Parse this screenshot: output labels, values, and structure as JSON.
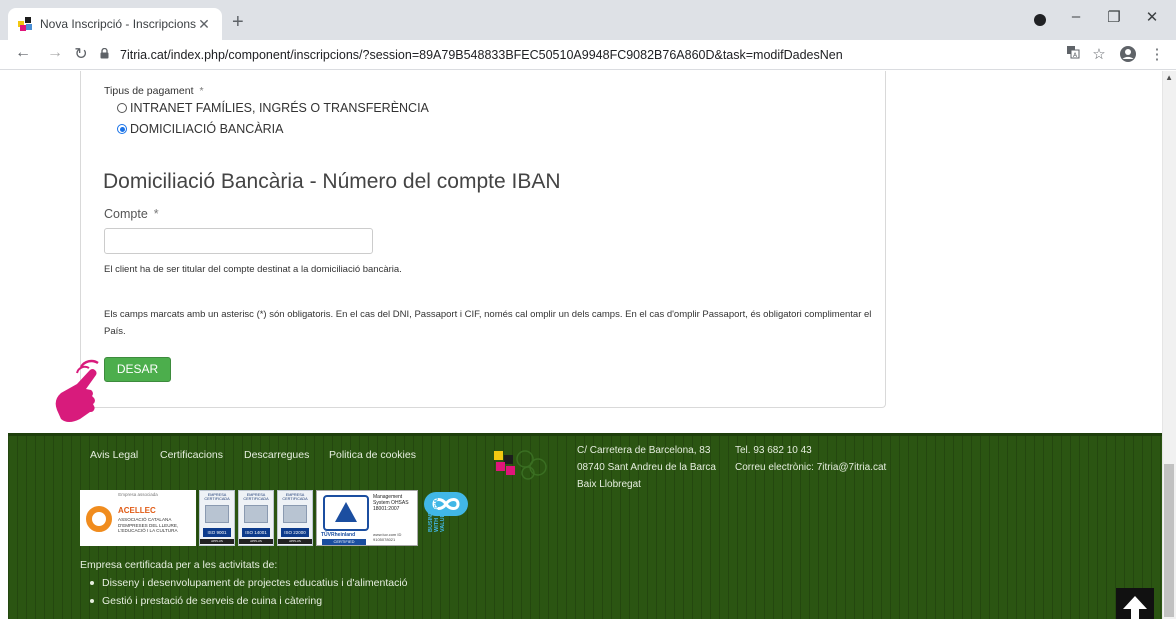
{
  "browser": {
    "tab_title": "Nova Inscripció - Inscripcions Me",
    "tab_close": "✕",
    "new_tab": "+",
    "url": "7itria.cat/index.php/component/inscripcions/?session=89A79B548833BFEC50510A9948FC9082B76A860D&task=modifDadesNen",
    "window_controls": {
      "minimize": "–",
      "restore": "❐",
      "close": "✕"
    },
    "nav": {
      "back": "←",
      "forward": "→",
      "reload": "↻"
    },
    "toolbar_icons": [
      "translate-icon",
      "star-icon",
      "profile-icon",
      "menu-icon"
    ]
  },
  "form": {
    "payment_label": "Tipus de pagament",
    "required_mark": "*",
    "payment_options": [
      {
        "label": "INTRANET FAMÍLIES, INGRÉS O TRANSFERÈNCIA",
        "selected": false
      },
      {
        "label": "DOMICILIACIÓ BANCÀRIA",
        "selected": true
      }
    ],
    "section_title": "Domiciliació Bancària - Número del compte IBAN",
    "account_label": "Compte",
    "account_value": "",
    "account_help": "El client ha de ser titular del compte destinat a la domiciliació bancària.",
    "required_note": "Els camps marcats amb un asterisc (*) són obligatoris. En el cas del DNI, Passaport i CIF, només cal omplir un dels camps. En el cas d'omplir Passaport, és obligatori complimentar el País.",
    "save_label": "DESAR"
  },
  "footer": {
    "links": [
      "Avis Legal",
      "Certificacions",
      "Descarregues",
      "Politica de cookies"
    ],
    "address": [
      "C/ Carretera de Barcelona, 83",
      "08740 Sant Andreu de la Barca",
      "Baix Llobregat"
    ],
    "phone": "Tel. 93 682 10 43",
    "email_line": "Correu electrònic: 7itria@7itria.cat",
    "badges": {
      "acellec_top": "Empresa associada",
      "acellec_name": "ACELLEC",
      "acellec_sub": "ASSOCIACIÓ CATALANA D'EMPRESES DEL LLEURE, L'EDUCACIÓ I LA CULTURA",
      "iso": [
        {
          "head": "EMPRESA CERTIFICADA",
          "code": "ISO 9001"
        },
        {
          "head": "EMPRESA CERTIFICADA",
          "code": "ISO 14001"
        },
        {
          "head": "EMPRESA CERTIFICADA",
          "code": "ISO 22000"
        }
      ],
      "iso_footer": "APPLUS",
      "tuv_brand": "TÜVRheinland",
      "tuv_cert": "CERTIFIED",
      "tuv_system": "Management System OHSAS 18001:2007",
      "tuv_url": "www.tuv.com ID 9105078021",
      "bsv_text": "BUSINESS WITH SOCIAL VALUE"
    },
    "cert_title": "Empresa certificada per a les activitats de:",
    "cert_items": [
      "Disseny i desenvolupament de projectes educatius i d'alimentació",
      "Gestió i prestació de serveis de cuina i càtering"
    ]
  },
  "colors": {
    "footer_bg": "#2b5512",
    "save_button": "#4cae4c",
    "radio_selected": "#1a73e8",
    "pointer_hand": "#d81b7c"
  }
}
